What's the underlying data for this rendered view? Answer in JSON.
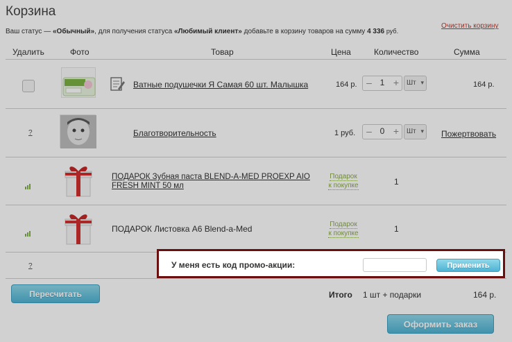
{
  "cart": {
    "title": "Корзина",
    "status_prefix": "Ваш статус — ",
    "status_value": "«Обычный»",
    "status_middle": ", для получения статуса ",
    "status_target": "«Любимый клиент»",
    "status_suffix": " добавьте в корзину товаров на сумму ",
    "status_amount": "4 336",
    "status_currency": "руб.",
    "clear_label": "Очистить корзину"
  },
  "table": {
    "headers": {
      "remove": "Удалить",
      "photo": "Фото",
      "product": "Товар",
      "price": "Цена",
      "quantity": "Количество",
      "sum": "Сумма"
    },
    "rows": [
      {
        "name": "Ватные подушечки Я Самая 60 шт. Малышка",
        "price": "164 р.",
        "qty": "1",
        "unit": "Шт",
        "sum": "164 р."
      },
      {
        "remove_hint": "?",
        "name": "Благотворительность",
        "price": "1 руб.",
        "qty": "0",
        "unit": "Шт",
        "sum": "Пожертвовать"
      },
      {
        "name": "ПОДАРОК Зубная паста BLEND-A-MED PROEXP AIO FRESH MINT 50 мл",
        "price_line1": "Подарок",
        "price_line2": "к покупке",
        "qty": "1"
      },
      {
        "name": "ПОДАРОК Листовка А6 Blend-a-Med",
        "price_line1": "Подарок",
        "price_line2": "к покупке",
        "qty": "1"
      }
    ],
    "promo_row_hint": "?"
  },
  "promo": {
    "label": "У меня есть код промо-акции:",
    "input_value": "",
    "apply_label": "Применить"
  },
  "footer": {
    "recalc_label": "Пересчитать",
    "total_label": "Итого",
    "total_qty": "1 шт + подарки",
    "total_sum": "164 р.",
    "checkout_label": "Оформить заказ"
  },
  "colors": {
    "accent_button": "#4fb3d4",
    "promo_border": "#6b0e0e",
    "clear_link": "#c0392b",
    "gift_label": "#8aaa4a"
  }
}
